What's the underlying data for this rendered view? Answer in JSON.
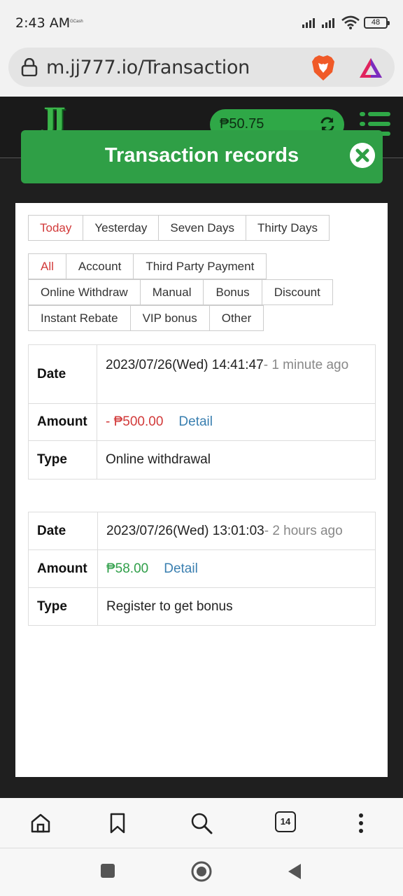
{
  "status_bar": {
    "time": "2:43 AM",
    "gcash": "GCash",
    "battery": "48"
  },
  "browser": {
    "url": "m.jj777.io/Transaction",
    "open_tabs": "14"
  },
  "site": {
    "logo": "JJ",
    "balance": "₱50.75"
  },
  "modal": {
    "title": "Transaction records",
    "period_tabs": [
      {
        "label": "Today",
        "active": true
      },
      {
        "label": "Yesterday",
        "active": false
      },
      {
        "label": "Seven Days",
        "active": false
      },
      {
        "label": "Thirty Days",
        "active": false
      }
    ],
    "filters": [
      {
        "label": "All",
        "active": true
      },
      {
        "label": "Account",
        "active": false
      },
      {
        "label": "Third Party Payment",
        "active": false
      },
      {
        "label": "Online Withdraw",
        "active": false
      },
      {
        "label": "Manual",
        "active": false
      },
      {
        "label": "Bonus",
        "active": false
      },
      {
        "label": "Discount",
        "active": false
      },
      {
        "label": "Instant Rebate",
        "active": false
      },
      {
        "label": "VIP bonus",
        "active": false
      },
      {
        "label": "Other",
        "active": false
      }
    ],
    "labels": {
      "date": "Date",
      "amount": "Amount",
      "type": "Type",
      "detail": "Detail"
    },
    "records": [
      {
        "date": "2023/07/26(Wed) 14:41:47",
        "relative": "- 1 minute ago",
        "amount": "- ₱500.00",
        "type": "Online withdrawal"
      },
      {
        "date": "2023/07/26(Wed) 13:01:03",
        "relative": "- 2 hours ago",
        "amount": "₱58.00",
        "type": "Register to get bonus"
      }
    ]
  },
  "colors": {
    "accent_green": "#2f9f46",
    "negative_red": "#d23a3a",
    "positive_green": "#2e9e48",
    "link_blue": "#3a7fb0"
  }
}
